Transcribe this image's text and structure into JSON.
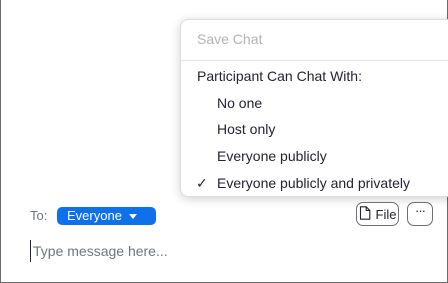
{
  "menu": {
    "save_chat": "Save Chat",
    "header": "Participant Can Chat With:",
    "options": [
      {
        "label": "No one",
        "selected": false
      },
      {
        "label": "Host only",
        "selected": false
      },
      {
        "label": "Everyone publicly",
        "selected": false
      },
      {
        "label": "Everyone publicly and privately",
        "selected": true
      }
    ],
    "check_glyph": "✓"
  },
  "recipient": {
    "to_label": "To:",
    "selected": "Everyone",
    "color": "#0e71eb"
  },
  "toolbar": {
    "file_label": "File",
    "more_glyph": "···"
  },
  "message": {
    "placeholder": "Type message here...",
    "value": ""
  }
}
